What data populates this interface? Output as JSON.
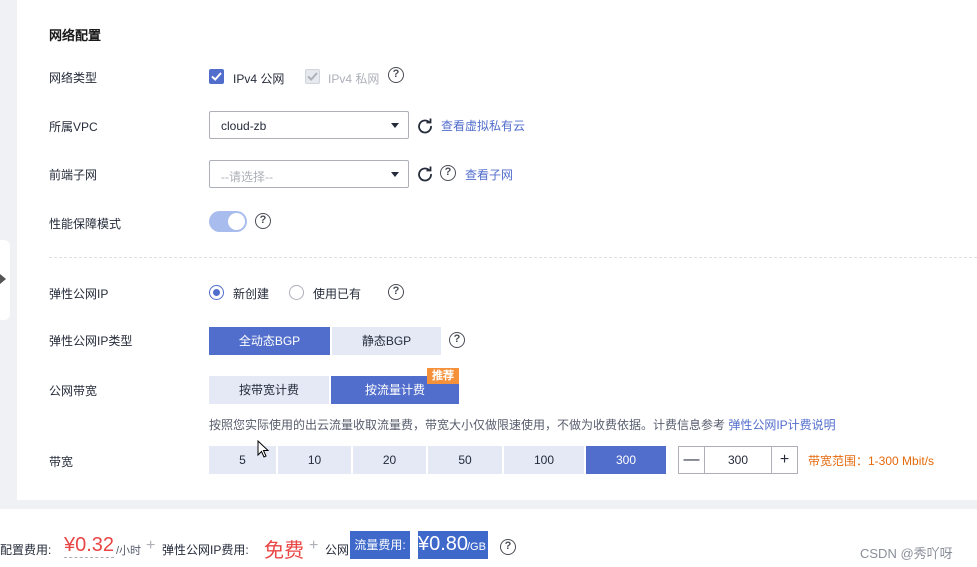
{
  "section": {
    "title": "网络配置"
  },
  "network_type": {
    "label": "网络类型",
    "ipv4_public": "IPv4 公网",
    "ipv4_private": "IPv4 私网"
  },
  "vpc": {
    "label": "所属VPC",
    "value": "cloud-zb",
    "link": "查看虚拟私有云"
  },
  "subnet": {
    "label": "前端子网",
    "placeholder": "--请选择--",
    "link": "查看子网"
  },
  "perf_mode": {
    "label": "性能保障模式",
    "enabled": true
  },
  "eip": {
    "label": "弹性公网IP",
    "options": [
      "新创建",
      "使用已有"
    ],
    "selected": "新创建"
  },
  "eip_type": {
    "label": "弹性公网IP类型",
    "options": [
      "全动态BGP",
      "静态BGP"
    ],
    "selected": "全动态BGP"
  },
  "bandwidth_billing": {
    "label": "公网带宽",
    "options": [
      "按带宽计费",
      "按流量计费"
    ],
    "selected": "按流量计费",
    "badge": "推荐",
    "hint": "按照您实际使用的出云流量收取流量费，带宽大小仅做限速使用，不做为收费依据。计费信息参考 ",
    "hint_link": "弹性公网IP计费说明"
  },
  "bandwidth": {
    "label": "带宽",
    "presets": [
      "5",
      "10",
      "20",
      "50",
      "100",
      "300"
    ],
    "selected": "300",
    "value": "300",
    "minus": "—",
    "plus": "+",
    "range": "带宽范围：1-300 Mbit/s"
  },
  "footer": {
    "config_fee_label": "配置费用:",
    "config_fee": "¥0.32",
    "config_fee_unit": "/小时",
    "eip_fee_label": "弹性公网IP费用:",
    "eip_fee": "免费",
    "public_label": "公网",
    "traffic_fee_label": "流量费用:",
    "traffic_fee": "¥0.80",
    "traffic_fee_unit": "/GB",
    "plus": "+"
  },
  "watermark": "CSDN @秀吖呀",
  "colors": {
    "accent": "#526ecc",
    "price": "#e94646",
    "badge": "#f6913b",
    "range": "#e56a0c"
  }
}
